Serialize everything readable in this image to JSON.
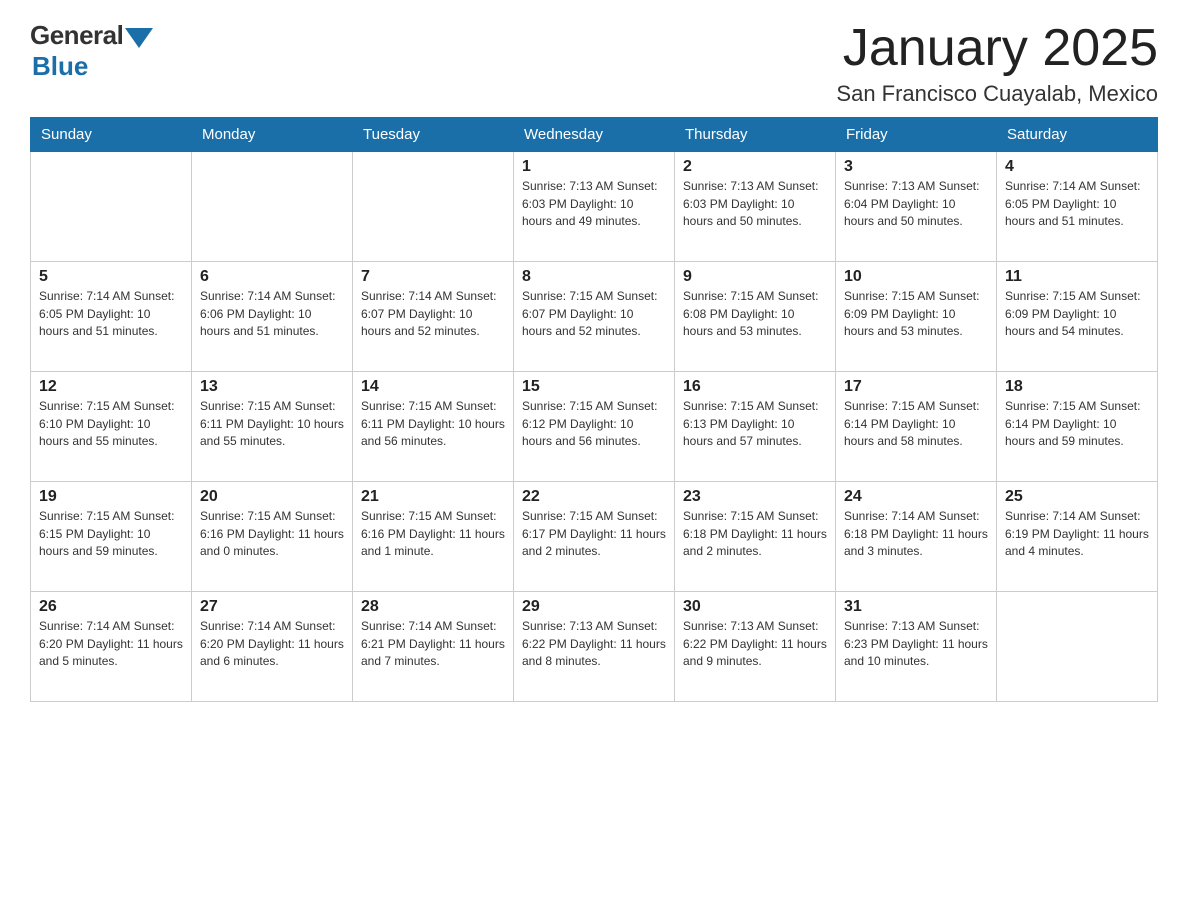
{
  "header": {
    "logo_general": "General",
    "logo_blue": "Blue",
    "month_title": "January 2025",
    "location": "San Francisco Cuayalab, Mexico"
  },
  "weekdays": [
    "Sunday",
    "Monday",
    "Tuesday",
    "Wednesday",
    "Thursday",
    "Friday",
    "Saturday"
  ],
  "weeks": [
    [
      {
        "day": "",
        "info": ""
      },
      {
        "day": "",
        "info": ""
      },
      {
        "day": "",
        "info": ""
      },
      {
        "day": "1",
        "info": "Sunrise: 7:13 AM\nSunset: 6:03 PM\nDaylight: 10 hours and 49 minutes."
      },
      {
        "day": "2",
        "info": "Sunrise: 7:13 AM\nSunset: 6:03 PM\nDaylight: 10 hours and 50 minutes."
      },
      {
        "day": "3",
        "info": "Sunrise: 7:13 AM\nSunset: 6:04 PM\nDaylight: 10 hours and 50 minutes."
      },
      {
        "day": "4",
        "info": "Sunrise: 7:14 AM\nSunset: 6:05 PM\nDaylight: 10 hours and 51 minutes."
      }
    ],
    [
      {
        "day": "5",
        "info": "Sunrise: 7:14 AM\nSunset: 6:05 PM\nDaylight: 10 hours and 51 minutes."
      },
      {
        "day": "6",
        "info": "Sunrise: 7:14 AM\nSunset: 6:06 PM\nDaylight: 10 hours and 51 minutes."
      },
      {
        "day": "7",
        "info": "Sunrise: 7:14 AM\nSunset: 6:07 PM\nDaylight: 10 hours and 52 minutes."
      },
      {
        "day": "8",
        "info": "Sunrise: 7:15 AM\nSunset: 6:07 PM\nDaylight: 10 hours and 52 minutes."
      },
      {
        "day": "9",
        "info": "Sunrise: 7:15 AM\nSunset: 6:08 PM\nDaylight: 10 hours and 53 minutes."
      },
      {
        "day": "10",
        "info": "Sunrise: 7:15 AM\nSunset: 6:09 PM\nDaylight: 10 hours and 53 minutes."
      },
      {
        "day": "11",
        "info": "Sunrise: 7:15 AM\nSunset: 6:09 PM\nDaylight: 10 hours and 54 minutes."
      }
    ],
    [
      {
        "day": "12",
        "info": "Sunrise: 7:15 AM\nSunset: 6:10 PM\nDaylight: 10 hours and 55 minutes."
      },
      {
        "day": "13",
        "info": "Sunrise: 7:15 AM\nSunset: 6:11 PM\nDaylight: 10 hours and 55 minutes."
      },
      {
        "day": "14",
        "info": "Sunrise: 7:15 AM\nSunset: 6:11 PM\nDaylight: 10 hours and 56 minutes."
      },
      {
        "day": "15",
        "info": "Sunrise: 7:15 AM\nSunset: 6:12 PM\nDaylight: 10 hours and 56 minutes."
      },
      {
        "day": "16",
        "info": "Sunrise: 7:15 AM\nSunset: 6:13 PM\nDaylight: 10 hours and 57 minutes."
      },
      {
        "day": "17",
        "info": "Sunrise: 7:15 AM\nSunset: 6:14 PM\nDaylight: 10 hours and 58 minutes."
      },
      {
        "day": "18",
        "info": "Sunrise: 7:15 AM\nSunset: 6:14 PM\nDaylight: 10 hours and 59 minutes."
      }
    ],
    [
      {
        "day": "19",
        "info": "Sunrise: 7:15 AM\nSunset: 6:15 PM\nDaylight: 10 hours and 59 minutes."
      },
      {
        "day": "20",
        "info": "Sunrise: 7:15 AM\nSunset: 6:16 PM\nDaylight: 11 hours and 0 minutes."
      },
      {
        "day": "21",
        "info": "Sunrise: 7:15 AM\nSunset: 6:16 PM\nDaylight: 11 hours and 1 minute."
      },
      {
        "day": "22",
        "info": "Sunrise: 7:15 AM\nSunset: 6:17 PM\nDaylight: 11 hours and 2 minutes."
      },
      {
        "day": "23",
        "info": "Sunrise: 7:15 AM\nSunset: 6:18 PM\nDaylight: 11 hours and 2 minutes."
      },
      {
        "day": "24",
        "info": "Sunrise: 7:14 AM\nSunset: 6:18 PM\nDaylight: 11 hours and 3 minutes."
      },
      {
        "day": "25",
        "info": "Sunrise: 7:14 AM\nSunset: 6:19 PM\nDaylight: 11 hours and 4 minutes."
      }
    ],
    [
      {
        "day": "26",
        "info": "Sunrise: 7:14 AM\nSunset: 6:20 PM\nDaylight: 11 hours and 5 minutes."
      },
      {
        "day": "27",
        "info": "Sunrise: 7:14 AM\nSunset: 6:20 PM\nDaylight: 11 hours and 6 minutes."
      },
      {
        "day": "28",
        "info": "Sunrise: 7:14 AM\nSunset: 6:21 PM\nDaylight: 11 hours and 7 minutes."
      },
      {
        "day": "29",
        "info": "Sunrise: 7:13 AM\nSunset: 6:22 PM\nDaylight: 11 hours and 8 minutes."
      },
      {
        "day": "30",
        "info": "Sunrise: 7:13 AM\nSunset: 6:22 PM\nDaylight: 11 hours and 9 minutes."
      },
      {
        "day": "31",
        "info": "Sunrise: 7:13 AM\nSunset: 6:23 PM\nDaylight: 11 hours and 10 minutes."
      },
      {
        "day": "",
        "info": ""
      }
    ]
  ]
}
